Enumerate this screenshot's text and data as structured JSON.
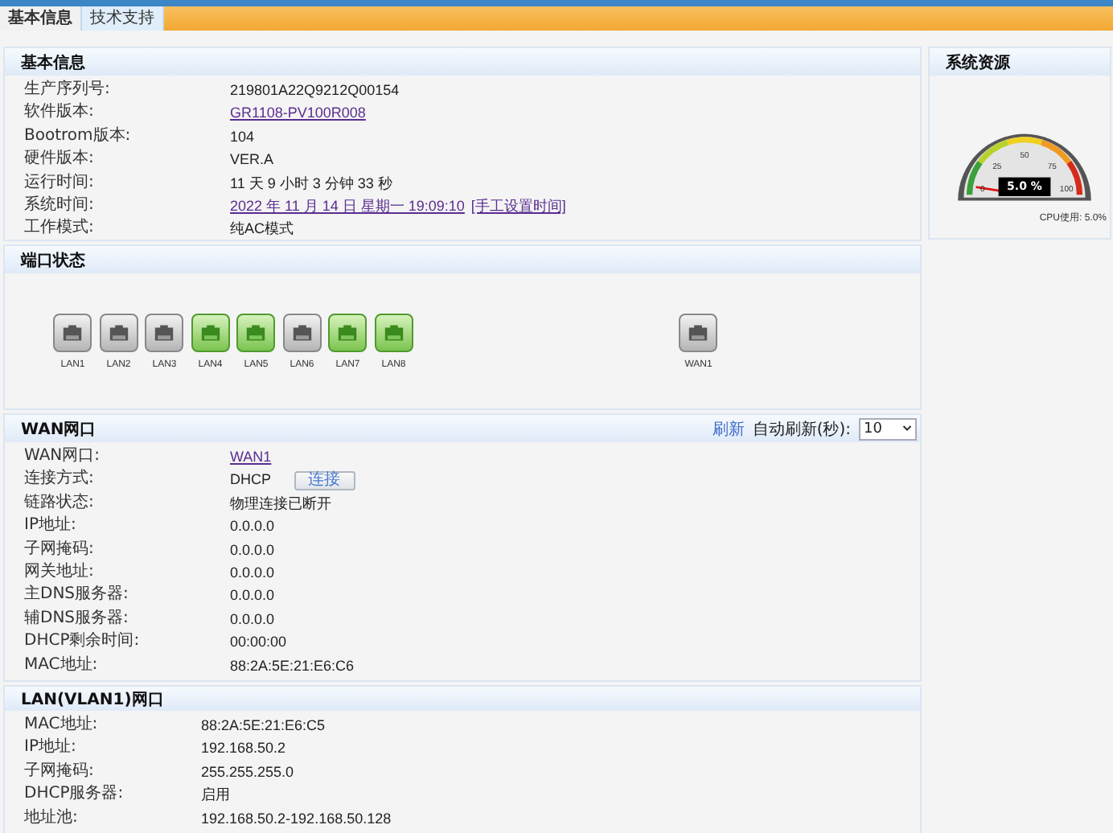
{
  "tabs": [
    {
      "label": "基本信息",
      "selected": true
    },
    {
      "label": "技术支持",
      "selected": false
    }
  ],
  "basic_info": {
    "title": "基本信息",
    "rows": [
      {
        "label": "生产序列号:",
        "kind": "text",
        "value": "219801A22Q9212Q00154"
      },
      {
        "label": "软件版本:",
        "kind": "link",
        "value": "GR1108-PV100R008"
      },
      {
        "label": "Bootrom版本:",
        "kind": "text",
        "value": "104"
      },
      {
        "label": "硬件版本:",
        "kind": "text",
        "value": "VER.A"
      },
      {
        "label": "运行时间:",
        "kind": "text",
        "value": "11 天 9 小时 3 分钟 33 秒"
      },
      {
        "label": "系统时间:",
        "kind": "link",
        "value": "2022 年 11 月 14 日 星期一 19:09:10",
        "action": "[手工设置时间]"
      },
      {
        "label": "工作模式:",
        "kind": "text",
        "value": "纯AC模式"
      }
    ]
  },
  "port_status": {
    "title": "端口状态",
    "ports": [
      {
        "label": "LAN1",
        "connected": false
      },
      {
        "label": "LAN2",
        "connected": false
      },
      {
        "label": "LAN3",
        "connected": false
      },
      {
        "label": "LAN4",
        "connected": true
      },
      {
        "label": "LAN5",
        "connected": true
      },
      {
        "label": "LAN6",
        "connected": false
      },
      {
        "label": "LAN7",
        "connected": true
      },
      {
        "label": "LAN8",
        "connected": true
      }
    ],
    "wan_ports": [
      {
        "label": "WAN1",
        "connected": false
      }
    ]
  },
  "wan": {
    "title": "WAN网口",
    "refresh_link": "刷新",
    "auto_refresh_label": "自动刷新(秒):",
    "auto_refresh_value": "10",
    "rows": [
      {
        "label": "WAN网口:",
        "kind": "link",
        "value": "WAN1"
      },
      {
        "label": "连接方式:",
        "kind": "text",
        "value": "DHCP",
        "button": "连接"
      },
      {
        "label": "链路状态:",
        "kind": "text",
        "value": "物理连接已断开"
      },
      {
        "label": "IP地址:",
        "kind": "text",
        "value": "0.0.0.0"
      },
      {
        "label": "子网掩码:",
        "kind": "text",
        "value": "0.0.0.0"
      },
      {
        "label": "网关地址:",
        "kind": "text",
        "value": "0.0.0.0"
      },
      {
        "label": "主DNS服务器:",
        "kind": "text",
        "value": "0.0.0.0"
      },
      {
        "label": "辅DNS服务器:",
        "kind": "text",
        "value": "0.0.0.0"
      },
      {
        "label": "DHCP剩余时间:",
        "kind": "text",
        "value": "00:00:00"
      },
      {
        "label": "MAC地址:",
        "kind": "text",
        "value": "88:2A:5E:21:E6:C6"
      }
    ]
  },
  "lan": {
    "title": "LAN(VLAN1)网口",
    "rows": [
      {
        "label": "MAC地址:",
        "kind": "text",
        "value": "88:2A:5E:21:E6:C5"
      },
      {
        "label": "IP地址:",
        "kind": "text",
        "value": "192.168.50.2"
      },
      {
        "label": "子网掩码:",
        "kind": "text",
        "value": "255.255.255.0"
      },
      {
        "label": "DHCP服务器:",
        "kind": "text",
        "value": "启用"
      },
      {
        "label": "地址池:",
        "kind": "text",
        "value": "192.168.50.2-192.168.50.128"
      }
    ]
  },
  "system_resources": {
    "title": "系统资源",
    "gauge": {
      "reading": "5.0 %",
      "ticks": [
        "0",
        "25",
        "50",
        "75",
        "100"
      ]
    },
    "caption": "CPU使用: 5.0%"
  }
}
